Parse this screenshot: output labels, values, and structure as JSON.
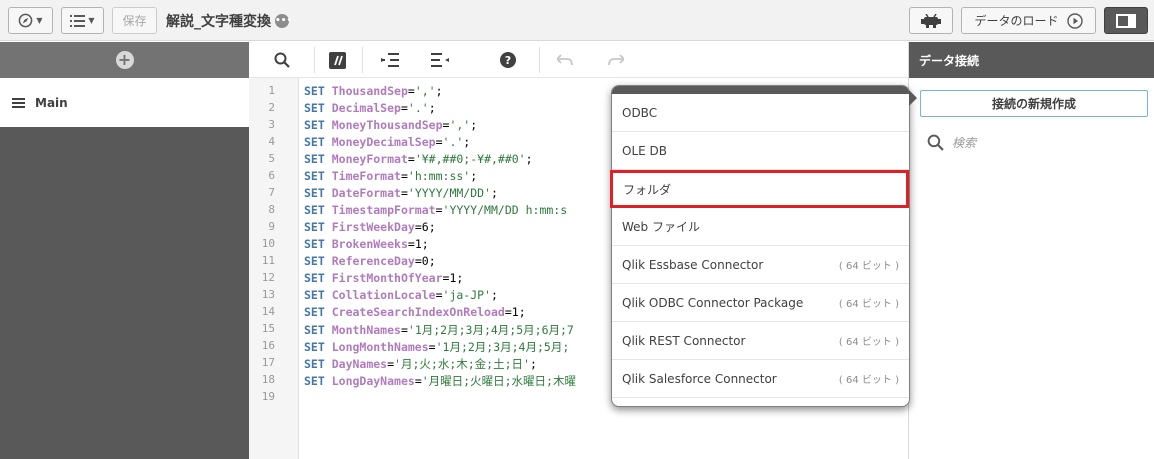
{
  "toolbar": {
    "save_label": "保存",
    "app_title": "解説_文字種変換",
    "load_data_label": "データのロード"
  },
  "left_panel": {
    "main_label": "Main"
  },
  "editor": {
    "line_numbers": [
      "1",
      "2",
      "3",
      "4",
      "5",
      "6",
      "7",
      "8",
      "9",
      "10",
      "11",
      "12",
      "13",
      "14",
      "15",
      "16",
      "17",
      "18",
      "19"
    ],
    "lines": [
      {
        "kw": "SET",
        "name": "ThousandSep",
        "value": "','",
        "tail": ";"
      },
      {
        "kw": "SET",
        "name": "DecimalSep",
        "value": "'.'",
        "tail": ";"
      },
      {
        "kw": "SET",
        "name": "MoneyThousandSep",
        "value": "','",
        "tail": ";"
      },
      {
        "kw": "SET",
        "name": "MoneyDecimalSep",
        "value": "'.'",
        "tail": ";"
      },
      {
        "kw": "SET",
        "name": "MoneyFormat",
        "value": "'¥#,##0;-¥#,##0'",
        "tail": ";"
      },
      {
        "kw": "SET",
        "name": "TimeFormat",
        "value": "'h:mm:ss'",
        "tail": ";"
      },
      {
        "kw": "SET",
        "name": "DateFormat",
        "value": "'YYYY/MM/DD'",
        "tail": ";"
      },
      {
        "kw": "SET",
        "name": "TimestampFormat",
        "value": "'YYYY/MM/DD h:mm:s",
        "tail": ""
      },
      {
        "kw": "SET",
        "name": "FirstWeekDay",
        "value": "6",
        "tail": ";"
      },
      {
        "kw": "SET",
        "name": "BrokenWeeks",
        "value": "1",
        "tail": ";"
      },
      {
        "kw": "SET",
        "name": "ReferenceDay",
        "value": "0",
        "tail": ";"
      },
      {
        "kw": "SET",
        "name": "FirstMonthOfYear",
        "value": "1",
        "tail": ";"
      },
      {
        "kw": "SET",
        "name": "CollationLocale",
        "value": "'ja-JP'",
        "tail": ";"
      },
      {
        "kw": "SET",
        "name": "CreateSearchIndexOnReload",
        "value": "1",
        "tail": ";"
      },
      {
        "kw": "SET",
        "name": "MonthNames",
        "value": "'1月;2月;3月;4月;5月;6月;7",
        "tail": ""
      },
      {
        "kw": "SET",
        "name": "LongMonthNames",
        "value": "'1月;2月;3月;4月;5月;",
        "tail": ""
      },
      {
        "kw": "SET",
        "name": "DayNames",
        "value": "'月;火;水;木;金;土;日'",
        "tail": ";"
      },
      {
        "kw": "SET",
        "name": "LongDayNames",
        "value": "'月曜日;火曜日;水曜日;木曜",
        "tail": ""
      }
    ]
  },
  "right_panel": {
    "header": "データ接続",
    "new_connection_label": "接続の新規作成",
    "search_placeholder": "検索"
  },
  "dropdown": {
    "items": [
      {
        "label": "ODBC",
        "bits": ""
      },
      {
        "label": "OLE DB",
        "bits": ""
      },
      {
        "label": "フォルダ",
        "bits": ""
      },
      {
        "label": "Web ファイル",
        "bits": ""
      },
      {
        "label": "Qlik Essbase Connector",
        "bits": "( 64 ビット )"
      },
      {
        "label": "Qlik ODBC Connector Package",
        "bits": "( 64 ビット )"
      },
      {
        "label": "Qlik REST Connector",
        "bits": "( 64 ビット )"
      },
      {
        "label": "Qlik Salesforce Connector",
        "bits": "( 64 ビット )"
      }
    ],
    "highlighted_index": 2,
    "highlight_color": "#e11f26"
  },
  "icons": [
    "compass-icon",
    "list-icon",
    "more-icon",
    "android-icon",
    "play-icon",
    "panel-toggle-icon",
    "add-icon",
    "menu-icon",
    "search-icon",
    "comment-icon",
    "indent-icon",
    "outdent-icon",
    "help-icon",
    "undo-icon",
    "redo-icon"
  ]
}
